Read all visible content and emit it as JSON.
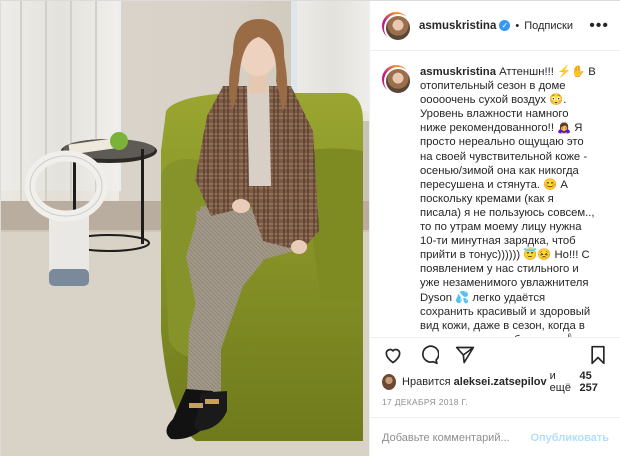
{
  "header": {
    "username": "asmuskristina",
    "separator": "•",
    "follow_label": "Подписки",
    "more_label": "•••"
  },
  "caption": {
    "username": "asmuskristina",
    "text": " Аттеншн!!! ⚡✋ В отопительный сезон в доме ооооочень сухой воздух 😳. Уровень влажности намного ниже рекомендованного!! 🙇‍♀️ Я просто нереально ощущаю это на своей чувствительной коже - осенью/зимой она как никогда пересушена и стянута. 😊 А поскольку кремами (как я писала) я не пользуюсь совсем.., то по утрам моему лицу нужна 10-ти минутная зарядка, чтоб прийти в тонус)))))) 😇😣 Но!!! С появлением у нас стильного и уже незаменимого увлажнителя Dyson 💦 легко удаётся сохранить красивый и здоровый вид кожи, даже в сезон, когда в доме тааак топят батареи. 🌡"
  },
  "likes": {
    "prefix": "Нравится",
    "user": "aleksei.zatsepilov",
    "middle": "и ещё",
    "count": "45 257"
  },
  "date": "17 ДЕКАБРЯ 2018 Г.",
  "comment": {
    "placeholder": "Добавьте комментарий...",
    "publish_label": "Опубликовать"
  },
  "icons": {
    "like": "heart-icon",
    "comment": "comment-bubble-icon",
    "share": "share-arrow-icon",
    "save": "bookmark-icon"
  },
  "colors": {
    "verified": "#3897f0",
    "publish_disabled": "#b2dffc",
    "muted": "#8e8e8e",
    "sofa": "#8c9a2a"
  }
}
